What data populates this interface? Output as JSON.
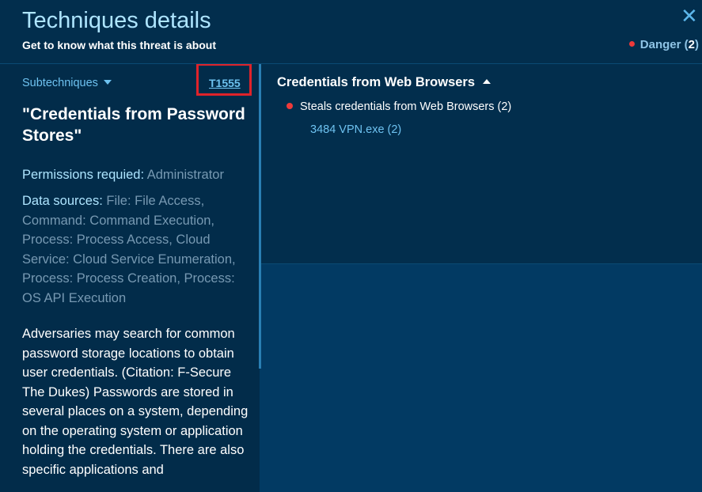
{
  "header": {
    "title": "Techniques details",
    "subtitle": "Get to know what this threat is about",
    "close_symbol": "✕",
    "danger_label": "Danger",
    "danger_count_open": " (",
    "danger_count": "2",
    "danger_count_close": ")",
    "danger_color": "#ee3a3a"
  },
  "left": {
    "subtechniques_label": "Subtechniques",
    "technique_id": "T1555",
    "technique_name": "\"Credentials from Password Stores\"",
    "permissions_label": "Permissions requied:",
    "permissions_value": " Administrator",
    "data_sources_label": "Data sources:",
    "data_sources_value": " File: File Access, Command: Command Execution, Process: Process Access, Cloud Service: Cloud Service Enumeration, Process: Process Creation, Process: OS API Execution",
    "description": "Adversaries may search for common password storage locations to obtain user credentials. (Citation: F-Secure The Dukes) Passwords are stored in several places on a system, depending on the operating system or application holding the credentials. There are also specific applications and"
  },
  "right": {
    "section_title": "Credentials from Web Browsers",
    "behavior": "Steals credentials from Web Browsers (2)",
    "process": "3484 VPN.exe (2)"
  },
  "colors": {
    "accent": "#6ec2f0",
    "title": "#aee5ff",
    "highlight": "#e0232a",
    "background": "#023a63"
  }
}
